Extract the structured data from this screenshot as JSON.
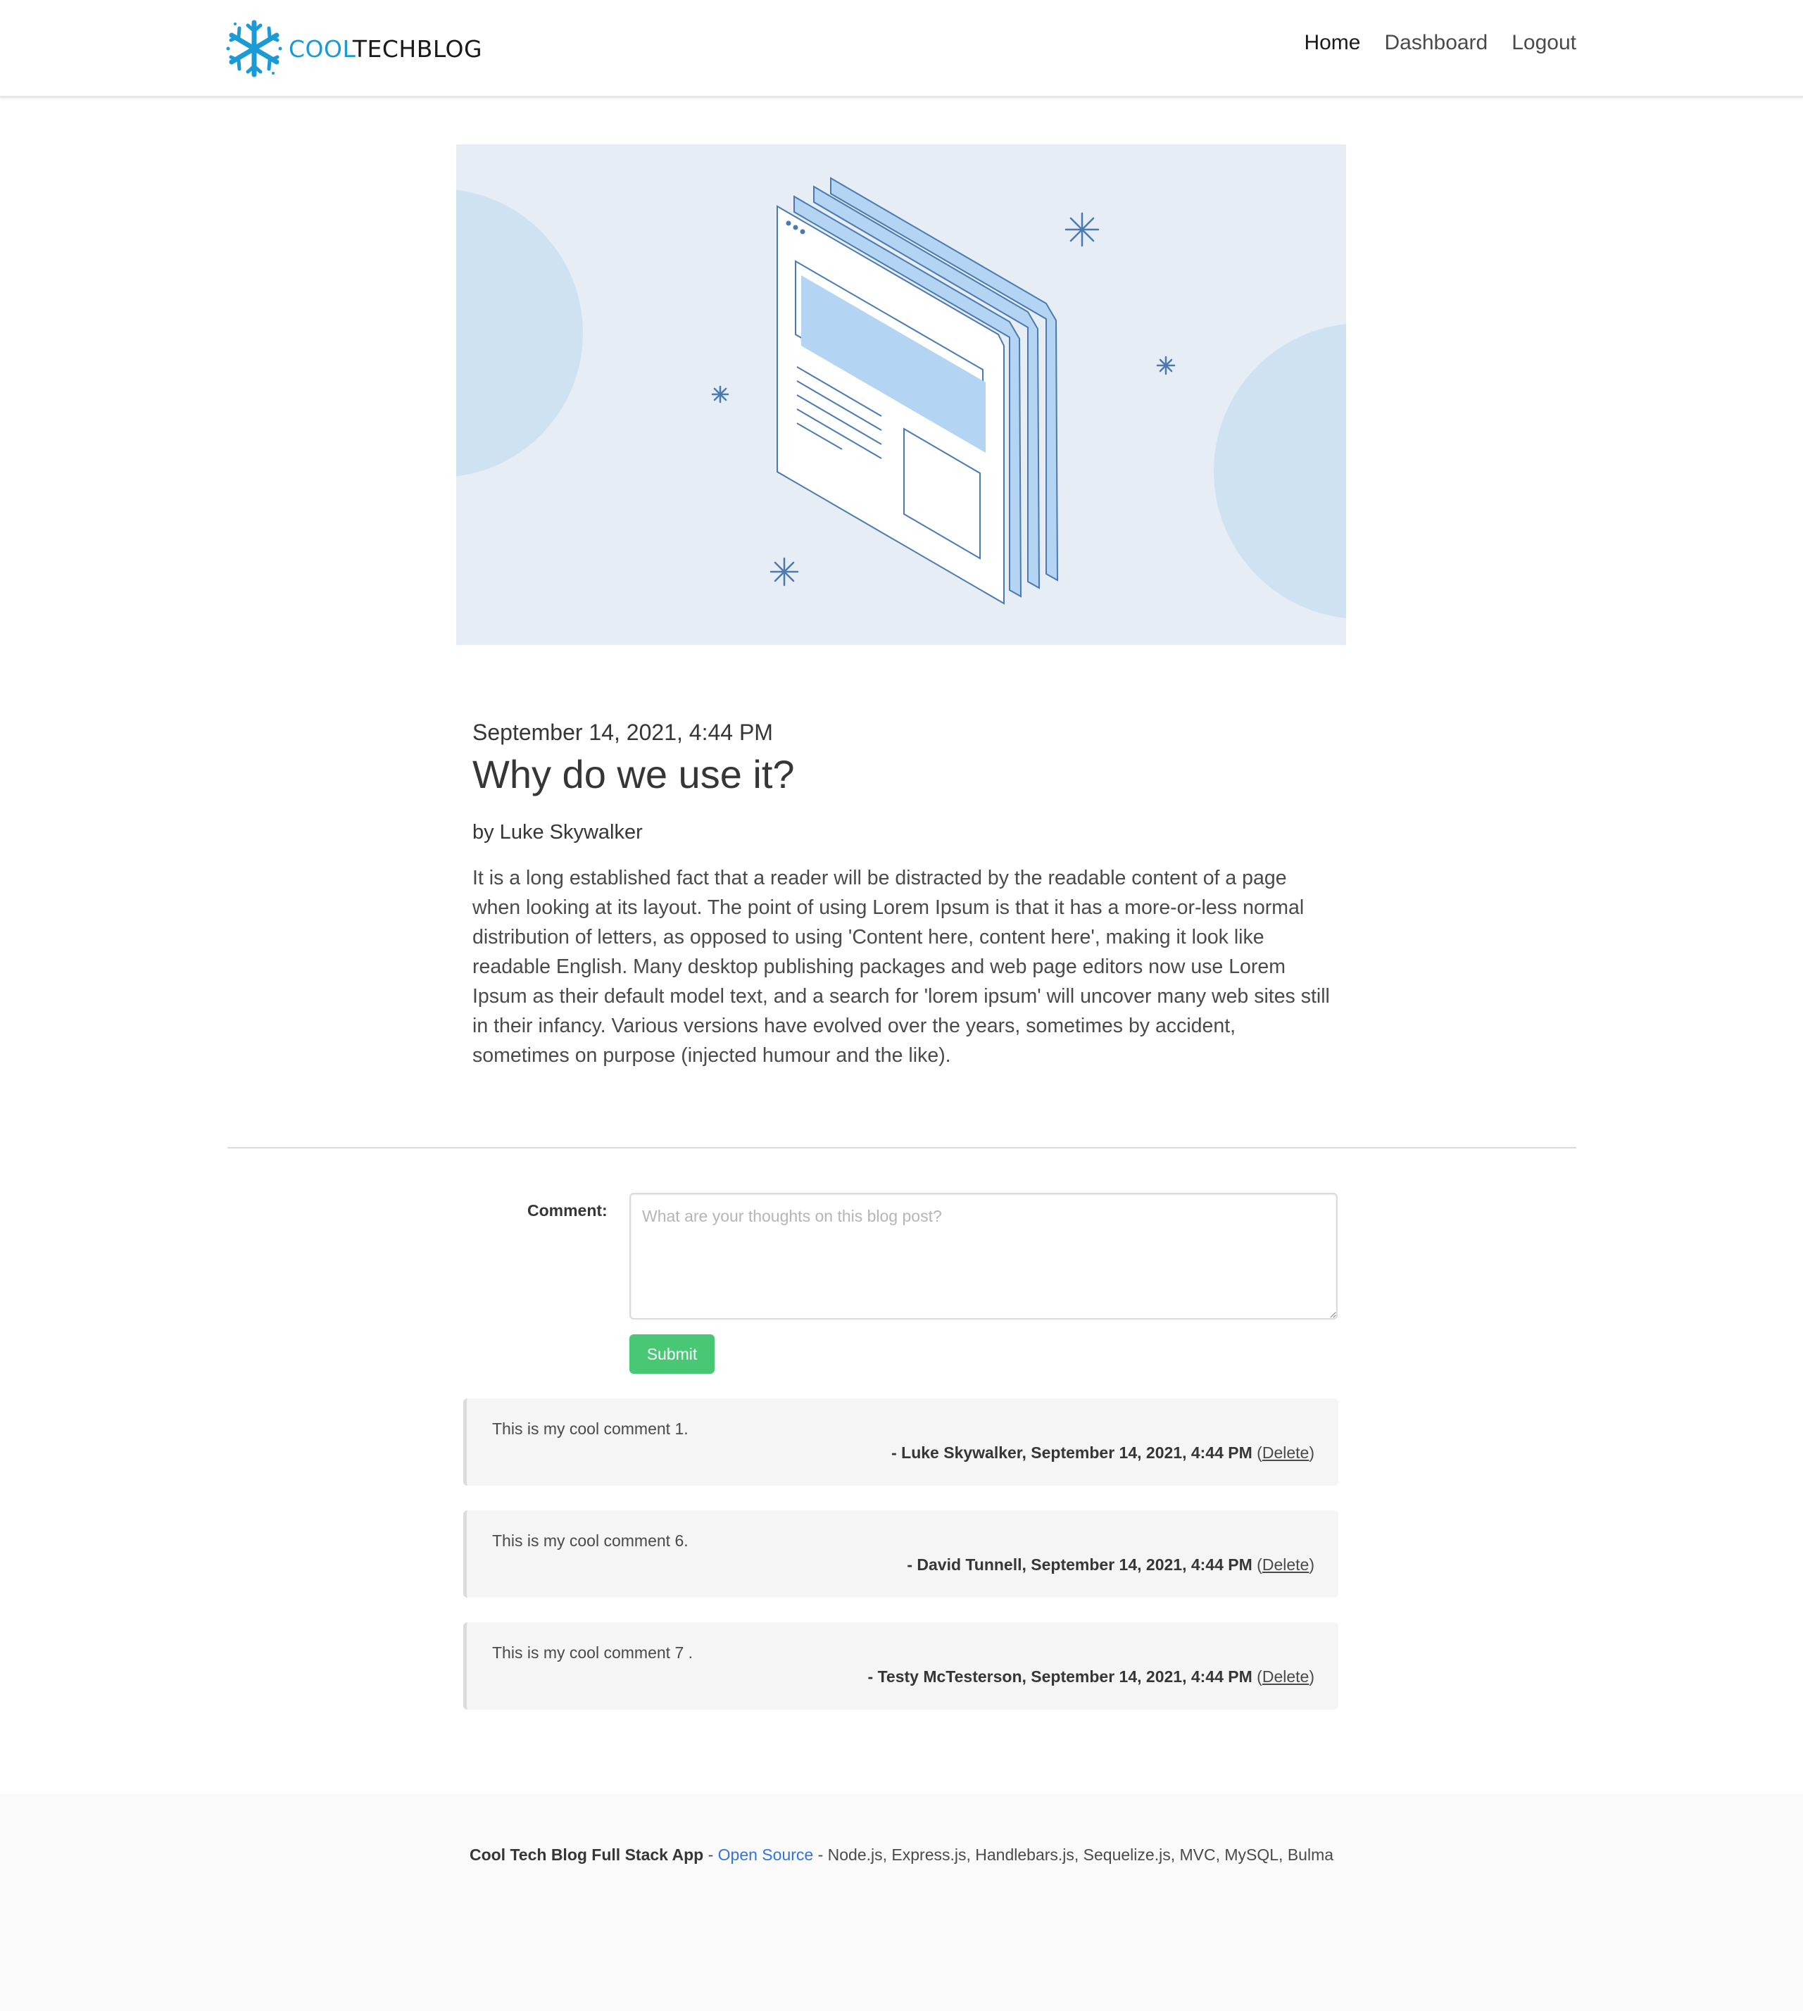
{
  "navbar": {
    "brand_cool": "COOL",
    "brand_techblog": "TECHBLOG",
    "links": {
      "home": "Home",
      "dashboard": "Dashboard",
      "logout": "Logout"
    }
  },
  "post": {
    "date": "September 14, 2021, 4:44 PM",
    "title": "Why do we use it?",
    "author": "by Luke Skywalker",
    "body": "It is a long established fact that a reader will be distracted by the readable content of a page when looking at its layout. The point of using Lorem Ipsum is that it has a more-or-less normal distribution of letters, as opposed to using 'Content here, content here', making it look like readable English. Many desktop publishing packages and web page editors now use Lorem Ipsum as their default model text, and a search for 'lorem ipsum' will uncover many web sites still in their infancy. Various versions have evolved over the years, sometimes by accident, sometimes on purpose (injected humour and the like)."
  },
  "comment_form": {
    "label": "Comment:",
    "placeholder": "What are your thoughts on this blog post?",
    "value": "",
    "submit_label": "Submit"
  },
  "comments": [
    {
      "text": "This is my cool comment 1.",
      "byline": "- Luke Skywalker, September 14, 2021, 4:44 PM",
      "delete_label": "Delete"
    },
    {
      "text": "This is my cool comment 6.",
      "byline": "- David Tunnell, September 14, 2021, 4:44 PM",
      "delete_label": "Delete"
    },
    {
      "text": "This is my cool comment 7 .",
      "byline": "- Testy McTesterson, September 14, 2021, 4:44 PM",
      "delete_label": "Delete"
    }
  ],
  "footer": {
    "app_name": "Cool Tech Blog Full Stack App",
    "sep1": " - ",
    "link": "Open Source",
    "sep2": " - ",
    "tech": "Node.js, Express.js, Handlebars.js, Sequelize.js, MVC, MySQL, Bulma"
  },
  "colors": {
    "brand_blue": "#1b9ad6",
    "submit_green": "#48c774",
    "hero_bg": "#e6edf4",
    "illustration_blue": "#b3d4f3",
    "footer_link": "#3273dc"
  },
  "icons": {
    "logo": "snowflake-icon",
    "hero": "browser-windows-illustration"
  }
}
